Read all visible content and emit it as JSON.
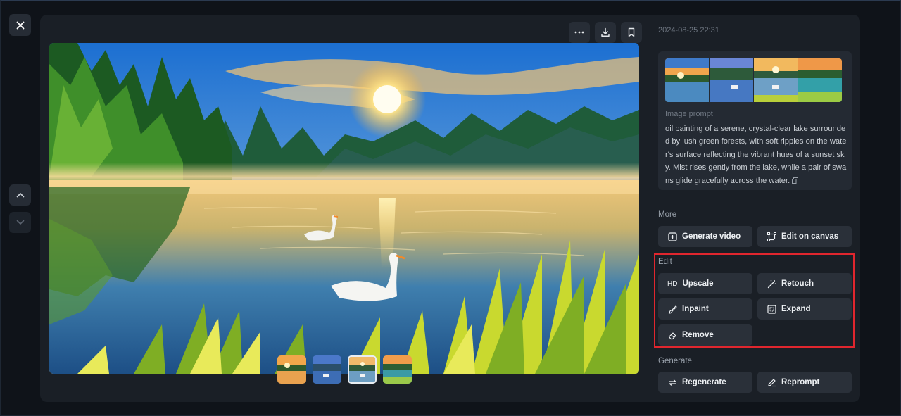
{
  "timestamp": "2024-08-25 22:31",
  "prompt": {
    "label": "Image prompt",
    "text": "oil painting of a serene, crystal-clear lake surrounded by lush green forests, with soft ripples on the water's surface reflecting the vibrant hues of a sunset sky. Mist rises gently from the lake, while a pair of swans glide gracefully across the water."
  },
  "sections": {
    "more": "More",
    "edit": "Edit",
    "generate": "Generate"
  },
  "actions": {
    "generate_video": "Generate video",
    "edit_on_canvas": "Edit on canvas",
    "upscale": "Upscale",
    "upscale_badge": "HD",
    "retouch": "Retouch",
    "inpaint": "Inpaint",
    "expand": "Expand",
    "remove": "Remove",
    "regenerate": "Regenerate",
    "reprompt": "Reprompt"
  },
  "thumbnails": {
    "count": 4,
    "selected_index": 2
  },
  "icons": [
    "close-icon",
    "chevron-up-icon",
    "chevron-down-icon",
    "more-icon",
    "download-icon",
    "bookmark-icon",
    "copy-icon"
  ],
  "colors": {
    "panel": "#1a1f26",
    "button": "#2a3039",
    "highlight": "#e0262e"
  }
}
